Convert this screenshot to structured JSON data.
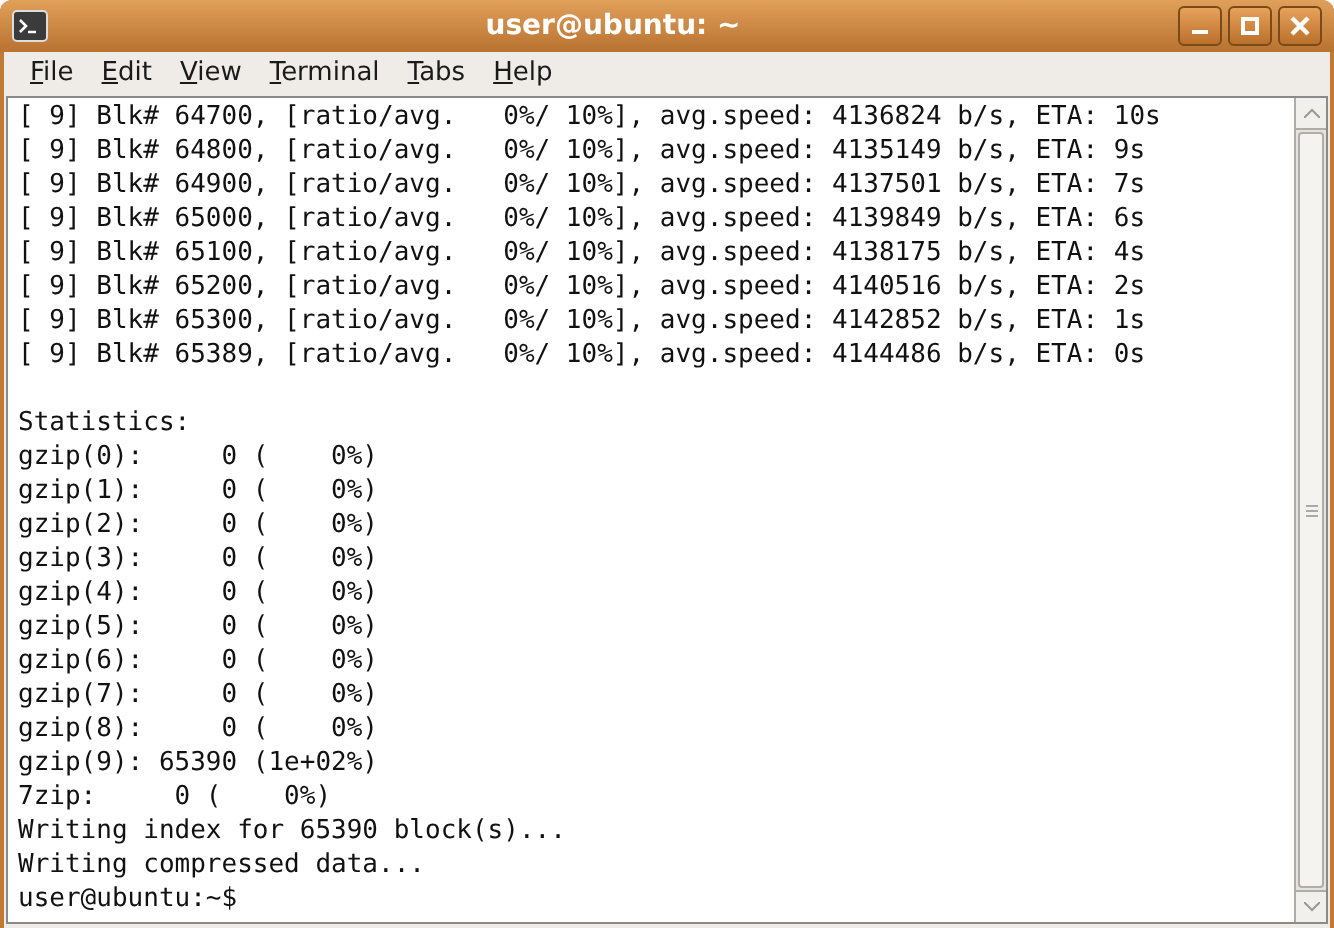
{
  "window": {
    "title": "user@ubuntu: ~"
  },
  "menu": [
    "File",
    "Edit",
    "View",
    "Terminal",
    "Tabs",
    "Help"
  ],
  "terminal": {
    "progress_lines": [
      "[ 9] Blk# 64700, [ratio/avg.   0%/ 10%], avg.speed: 4136824 b/s, ETA: 10s",
      "[ 9] Blk# 64800, [ratio/avg.   0%/ 10%], avg.speed: 4135149 b/s, ETA: 9s",
      "[ 9] Blk# 64900, [ratio/avg.   0%/ 10%], avg.speed: 4137501 b/s, ETA: 7s",
      "[ 9] Blk# 65000, [ratio/avg.   0%/ 10%], avg.speed: 4139849 b/s, ETA: 6s",
      "[ 9] Blk# 65100, [ratio/avg.   0%/ 10%], avg.speed: 4138175 b/s, ETA: 4s",
      "[ 9] Blk# 65200, [ratio/avg.   0%/ 10%], avg.speed: 4140516 b/s, ETA: 2s",
      "[ 9] Blk# 65300, [ratio/avg.   0%/ 10%], avg.speed: 4142852 b/s, ETA: 1s",
      "[ 9] Blk# 65389, [ratio/avg.   0%/ 10%], avg.speed: 4144486 b/s, ETA: 0s"
    ],
    "statistics_lines": [
      "Statistics:",
      "gzip(0):     0 (    0%)",
      "gzip(1):     0 (    0%)",
      "gzip(2):     0 (    0%)",
      "gzip(3):     0 (    0%)",
      "gzip(4):     0 (    0%)",
      "gzip(5):     0 (    0%)",
      "gzip(6):     0 (    0%)",
      "gzip(7):     0 (    0%)",
      "gzip(8):     0 (    0%)",
      "gzip(9): 65390 (1e+02%)",
      "7zip:     0 (    0%)",
      "Writing index for 65390 block(s)...",
      "Writing compressed data...",
      "user@ubuntu:~$"
    ]
  }
}
